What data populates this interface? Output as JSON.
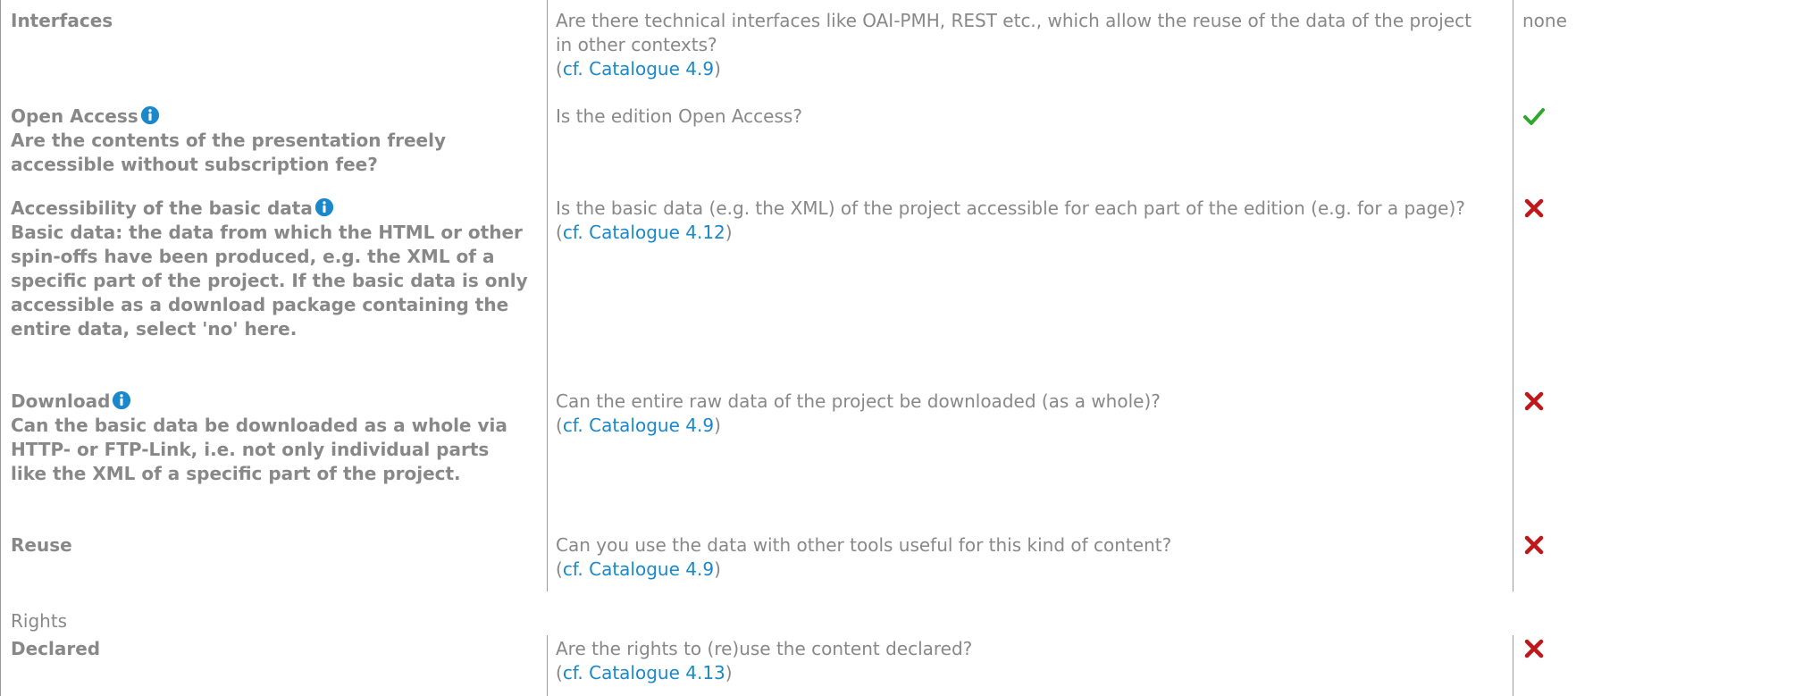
{
  "colors": {
    "text": "#888888",
    "link": "#1a88c9",
    "check": "#2ea829",
    "cross": "#c0171a",
    "info": "#1a88c9"
  },
  "rows": [
    {
      "label": "Interfaces",
      "note": "",
      "has_info": false,
      "question": "Are there technical interfaces like OAI-PMH, REST etc., which allow the reuse of the data of the project in other contexts?",
      "ref": "cf. Catalogue 4.9",
      "answer": "none",
      "answer_icon": ""
    },
    {
      "label": "Open Access",
      "note": "Are the contents of the presentation freely accessible without subscription fee?",
      "has_info": true,
      "question": "Is the edition Open Access?",
      "ref": "",
      "answer": "",
      "answer_icon": "check-icon"
    },
    {
      "label": "Accessibility of the basic data",
      "note": "Basic data: the data from which the HTML or other spin-offs have been produced, e.g. the XML of a specific part of the project. If the basic data is only accessible as a download package containing the entire data, select 'no' here.",
      "has_info": true,
      "question": "Is the basic data (e.g. the XML) of the project accessible for each part of the edition (e.g. for a page)?",
      "ref": "cf. Catalogue 4.12",
      "answer": "",
      "answer_icon": "cross-icon"
    },
    {
      "label": "Download",
      "note": "Can the basic data be downloaded as a whole via HTTP- or FTP-Link, i.e. not only individual parts like the XML of a specific part of the project.",
      "has_info": true,
      "question": "Can the entire raw data of the project be downloaded (as a whole)?",
      "ref": "cf. Catalogue 4.9",
      "answer": "",
      "answer_icon": "cross-icon"
    },
    {
      "label": "Reuse",
      "note": "",
      "has_info": false,
      "question": "Can you use the data with other tools useful for this kind of content?",
      "ref": "cf. Catalogue 4.9",
      "answer": "",
      "answer_icon": "cross-icon"
    }
  ],
  "section": {
    "title": "Rights"
  },
  "rights_rows": [
    {
      "label": "Declared",
      "note": "",
      "has_info": false,
      "question": "Are the rights to (re)use the content declared?",
      "ref": "cf. Catalogue 4.13",
      "answer": "",
      "answer_icon": "cross-icon"
    }
  ],
  "paren_open": "(",
  "paren_close": ")"
}
